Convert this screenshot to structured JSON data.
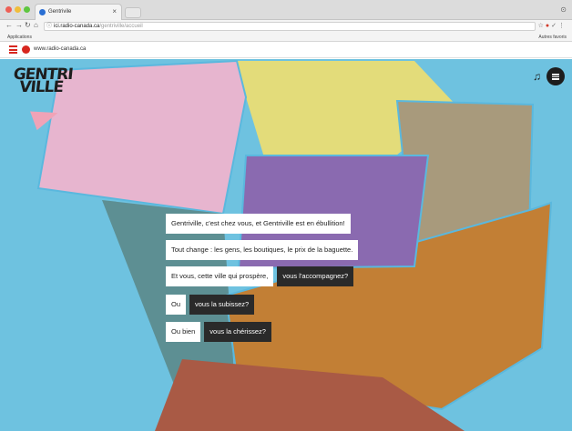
{
  "browser": {
    "tab_title": "Gentrivile",
    "url_host": "ici.radio-canada.ca",
    "url_path": "/gentriville/accueil",
    "bookmark_left": "Applications",
    "bookmark_right": "Autres favoris"
  },
  "banner": {
    "site_label": "www.radio-canada.ca"
  },
  "header": {
    "logo_line1": "GENTRI",
    "logo_line2": "VILLE",
    "icons": [
      "music-icon",
      "menu-icon"
    ]
  },
  "dialogue": {
    "line1": "Gentriville, c'est chez vous, et Gentriville est en ébullition!",
    "line2": "Tout change : les gens, les boutiques, le prix de la baguette.",
    "line3_text": "Et vous, cette ville qui prospère,",
    "line3_choice": "vous l'accompagnez?",
    "line4_text": "Ou",
    "line4_choice": "vous la subissez?",
    "line5_text": "Ou bien",
    "line5_choice": "vous la chérissez?"
  },
  "colors": {
    "sky": "#6ec2e0",
    "pink": "#e7b5cf",
    "yellow": "#e3dc7a",
    "purple": "#8a6ab0",
    "taupe": "#a89a7c",
    "orange": "#c27f35",
    "teal": "#5d8f93",
    "rust": "#a95a45",
    "brand_red": "#d7261e"
  }
}
